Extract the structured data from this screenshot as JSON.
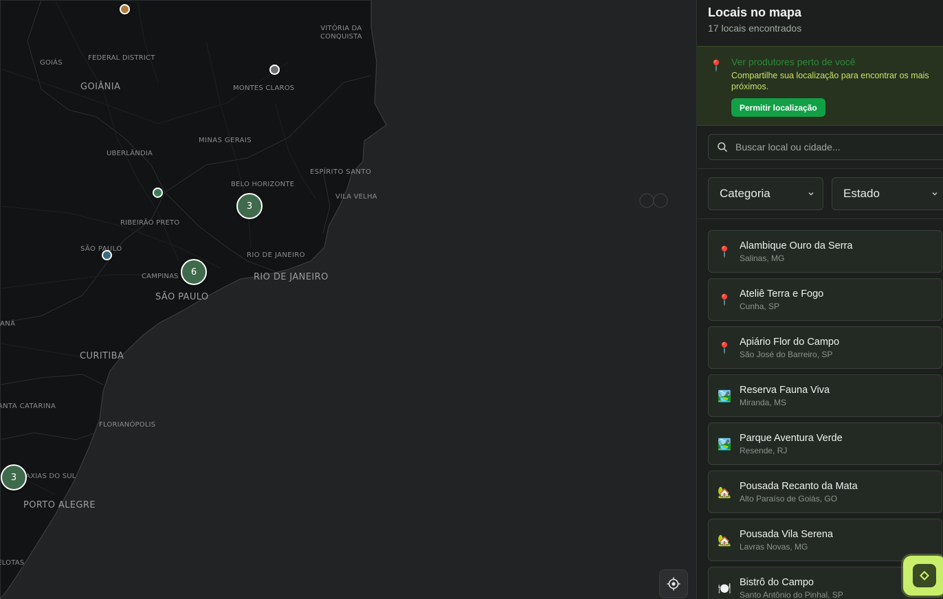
{
  "map": {
    "labels_big": [
      "GOIÂNIA",
      "SÃO PAULO",
      "RIO DE JANEIRO",
      "CURITIBA",
      "PORTO ALEGRE"
    ],
    "labels": {
      "vitoria": "VITÓRIA DA\nCONQUISTA",
      "goias": "GOIÁS",
      "federal": "FEDERAL DISTRICT",
      "montes": "MONTES CLAROS",
      "minas": "MINAS GERAIS",
      "uberlandia": "UBERLÂNDIA",
      "espirito": "ESPÍRITO SANTO",
      "belo": "BELO HORIZONTE",
      "vila": "VILA VELHA",
      "ribeirao": "RIBEIRÃO PRETO",
      "saopaulo_state": "SÃO PAULO",
      "riodejaneiro_state": "RIO DE JANEIRO",
      "campinas": "CAMPINAS",
      "parana": "PARANÁ",
      "santa": "SANTA CATARINA",
      "floripa": "FLORIANÓPOLIS",
      "caxias": "CAXIAS DO SUL",
      "pelotas": "PELOTAS"
    },
    "clusters": [
      "3",
      "6",
      "3"
    ],
    "pin_colors": [
      "#b07a3a",
      "#6c6e70",
      "#3f7a55",
      "#3a6a86"
    ],
    "locate_icon": "crosshair-icon"
  },
  "sidebar": {
    "title": "Locais no mapa",
    "count": "17 locais encontrados",
    "banner": {
      "title": "Ver produtores perto de você",
      "text": "Compartilhe sua localização para encontrar os mais próximos.",
      "button": "Permitir localização"
    },
    "search": {
      "placeholder": "Buscar local ou cidade..."
    },
    "filters": {
      "category": "Categoria",
      "state": "Estado"
    },
    "items": [
      {
        "name": "Alambique Ouro da Serra",
        "city": "Salinas, MG",
        "icon": "📍"
      },
      {
        "name": "Ateliê Terra e Fogo",
        "city": "Cunha, SP",
        "icon": "📍"
      },
      {
        "name": "Apiário Flor do Campo",
        "city": "São José do Barreiro, SP",
        "icon": "📍"
      },
      {
        "name": "Reserva Fauna Viva",
        "city": "Miranda, MS",
        "icon": "🏞️"
      },
      {
        "name": "Parque Aventura Verde",
        "city": "Resende, RJ",
        "icon": "🏞️"
      },
      {
        "name": "Pousada Recanto da Mata",
        "city": "Alto Paraíso de Goiás, GO",
        "icon": "🏡"
      },
      {
        "name": "Pousada Vila Serena",
        "city": "Lavras Novas, MG",
        "icon": "🏡"
      },
      {
        "name": "Bistrô do Campo",
        "city": "Santo Antônio do Pinhal, SP",
        "icon": "🍽️"
      }
    ]
  },
  "colors": {
    "accent": "#12a047",
    "cluster": "#3f6b4c",
    "fab": "#c9ee6b"
  }
}
